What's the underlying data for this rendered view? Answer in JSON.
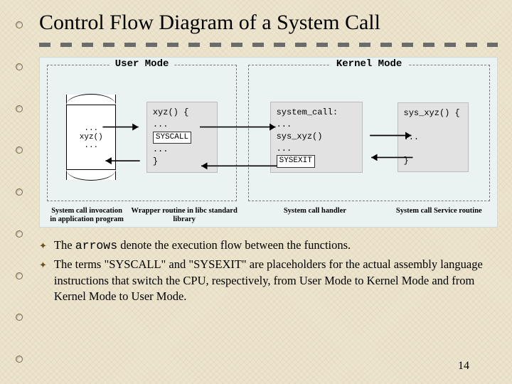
{
  "title": "Control Flow Diagram of a System Call",
  "mode_labels": {
    "user": "User Mode",
    "kernel": "Kernel Mode"
  },
  "scroll_text": "...\nxyz()\n...",
  "wrapper": {
    "head": "xyz() {",
    "dots": "...",
    "syscall": "SYSCALL",
    "close": "}"
  },
  "handler": {
    "head": "system_call:",
    "dots1": "...",
    "call": "sys_xyz()",
    "dots2": "...",
    "sysexit": "SYSEXIT"
  },
  "service": {
    "head": "sys_xyz() {",
    "dots": "...",
    "close": "}"
  },
  "captions": {
    "c1": "System call invocation in application program",
    "c2": "Wrapper routine in libc standard library",
    "c3": "System call handler",
    "c4": "System call Service routine"
  },
  "bullets": {
    "b1_pre": "The ",
    "b1_code": "arrows",
    "b1_post": " denote the execution flow between the functions.",
    "b2": "The terms \"SYSCALL\" and \"SYSEXIT\" are placeholders for the actual assembly language instructions that switch the CPU, respectively, from User Mode to Kernel Mode and from Kernel Mode to User Mode."
  },
  "page_number": "14"
}
